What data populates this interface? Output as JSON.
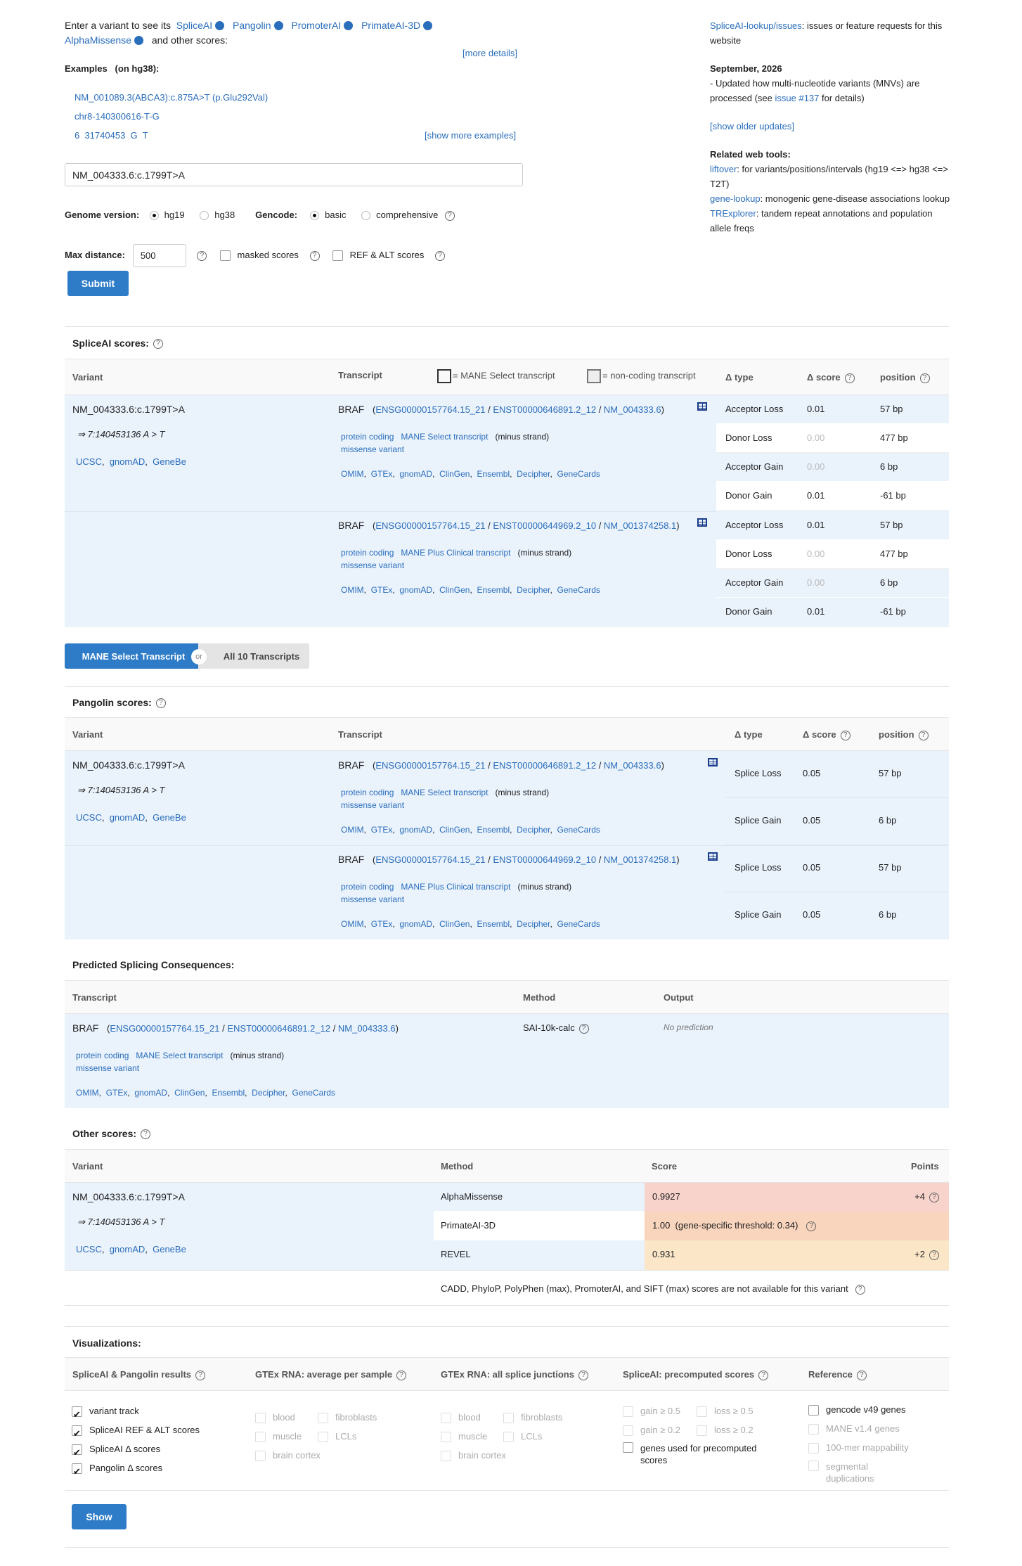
{
  "intro": {
    "line1": "Enter a variant to see its",
    "tools": [
      "SpliceAI",
      "Pangolin",
      "PromoterAI",
      "PrimateAI-3D"
    ],
    "tool5": "AlphaMissense",
    "line2_tail": "and other scores:",
    "more_details": "[more details]"
  },
  "examples": {
    "title": "Examples",
    "subtitle": "(on hg38):",
    "items": [
      "NM_001089.3(ABCA3):c.875A>T (p.Glu292Val)",
      "chr8-140300616-T-G",
      "6  31740453  G  T"
    ],
    "show_more": "[show more examples]"
  },
  "search": {
    "value": "NM_004333.6:c.1799T>A"
  },
  "genome": {
    "label": "Genome version:",
    "opt1": "hg19",
    "opt2": "hg38"
  },
  "gencode": {
    "label": "Gencode:",
    "opt1": "basic",
    "opt2": "comprehensive"
  },
  "maxdist": {
    "label": "Max distance:",
    "value": "500",
    "masked": "masked scores",
    "refalt": "REF & ALT scores"
  },
  "submit": "Submit",
  "sidebar": {
    "issues_link": "SpliceAI-lookup/issues",
    "issues_tail": ": issues or feature requests for this website",
    "date": "September, 2026",
    "update_pre": "- Updated how multi-nucleotide variants (MNVs) are processed (see ",
    "update_link": "issue #137",
    "update_post": " for details)",
    "older": "[show older updates]",
    "related_title": "Related web tools:",
    "t1_link": "liftover",
    "t1_text": ": for variants/positions/intervals (hg19 <=> hg38 <=> T2T)",
    "t2_link": "gene-lookup",
    "t2_text": ": monogenic gene-disease associations lookup",
    "t3_link": "TRExplorer",
    "t3_text": ": tandem repeat annotations and population allele freqs"
  },
  "variant": {
    "name": "NM_004333.6:c.1799T>A",
    "hg": "⇒ 7:140453136 A > T",
    "links": [
      "UCSC",
      "gnomAD",
      "GeneBe"
    ]
  },
  "tx": {
    "gene": "BRAF",
    "t1": {
      "ensg": "ENSG00000157764.15_21",
      "enst": "ENST00000646891.2_12",
      "nm": "NM_004333.6",
      "tag": "MANE Select transcript"
    },
    "t2": {
      "ensg": "ENSG00000157764.15_21",
      "enst": "ENST00000644969.2_10",
      "nm": "NM_001374258.1",
      "tag": "MANE Plus Clinical transcript"
    },
    "coding": "protein coding",
    "strand": "(minus strand)",
    "missense": "missense variant",
    "dbs": [
      "OMIM",
      "GTEx",
      "gnomAD",
      "ClinGen",
      "Ensembl",
      "Decipher",
      "GeneCards"
    ]
  },
  "spliceai": {
    "title": "SpliceAI scores:",
    "h_variant": "Variant",
    "h_transcript": "Transcript",
    "legend_mane": "= MANE Select transcript",
    "legend_nc": "= non-coding transcript",
    "h_type": "Δ type",
    "h_score": "Δ score",
    "h_pos": "position",
    "rows": [
      {
        "type": "Acceptor Loss",
        "score": "0.01",
        "pos": "57 bp"
      },
      {
        "type": "Donor Loss",
        "score": "0.00",
        "pos": "477 bp"
      },
      {
        "type": "Acceptor Gain",
        "score": "0.00",
        "pos": "6 bp"
      },
      {
        "type": "Donor Gain",
        "score": "0.01",
        "pos": "-61 bp"
      },
      {
        "type": "Acceptor Loss",
        "score": "0.01",
        "pos": "57 bp"
      },
      {
        "type": "Donor Loss",
        "score": "0.00",
        "pos": "477 bp"
      },
      {
        "type": "Acceptor Gain",
        "score": "0.00",
        "pos": "6 bp"
      },
      {
        "type": "Donor Gain",
        "score": "0.01",
        "pos": "-61 bp"
      }
    ]
  },
  "toggle": {
    "mane": "MANE Select Transcript",
    "or": "or",
    "all": "All 10 Transcripts"
  },
  "pangolin": {
    "title": "Pangolin scores:",
    "rows": [
      {
        "type": "Splice Loss",
        "score": "0.05",
        "pos": "57 bp"
      },
      {
        "type": "Splice Gain",
        "score": "0.05",
        "pos": "6 bp"
      },
      {
        "type": "Splice Loss",
        "score": "0.05",
        "pos": "57 bp"
      },
      {
        "type": "Splice Gain",
        "score": "0.05",
        "pos": "6 bp"
      }
    ]
  },
  "consequences": {
    "title": "Predicted Splicing Consequences:",
    "h_transcript": "Transcript",
    "h_method": "Method",
    "h_output": "Output",
    "method": "SAI-10k-calc",
    "output": "No prediction"
  },
  "other": {
    "title": "Other scores:",
    "h_variant": "Variant",
    "h_method": "Method",
    "h_score": "Score",
    "h_points": "Points",
    "rows": [
      {
        "method": "AlphaMissense",
        "score": "0.9927",
        "points": "+4",
        "color": "#f8d3cc"
      },
      {
        "method": "PrimateAI-3D",
        "score": "1.00",
        "extra": "(gene-specific threshold: 0.34)",
        "points": "",
        "color": "#f9d5bd"
      },
      {
        "method": "REVEL",
        "score": "0.931",
        "points": "+2",
        "color": "#fbe6c8"
      }
    ],
    "na": "CADD,  PhyloP,  PolyPhen (max),  PromoterAI,  and SIFT (max) scores are not available for this variant"
  },
  "viz": {
    "title": "Visualizations:",
    "c1": "SpliceAI & Pangolin results",
    "c2": "GTEx RNA: average per sample",
    "c3": "GTEx RNA: all splice junctions",
    "c4": "SpliceAI: precomputed scores",
    "c5": "Reference",
    "c1_items": [
      "variant track",
      "SpliceAI REF & ALT scores",
      "SpliceAI Δ  scores",
      "Pangolin Δ  scores"
    ],
    "tissues": [
      "blood",
      "fibroblasts",
      "muscle",
      "LCLs",
      "brain cortex"
    ],
    "pre": [
      "gain ≥ 0.5",
      "loss ≥ 0.5",
      "gain ≥ 0.2",
      "loss ≥ 0.2"
    ],
    "pre_genes": "genes used for precomputed scores",
    "ref": [
      "gencode v49 genes",
      "MANE v1.4 genes",
      "100-mer mappability",
      "segmental duplications"
    ],
    "show": "Show"
  }
}
